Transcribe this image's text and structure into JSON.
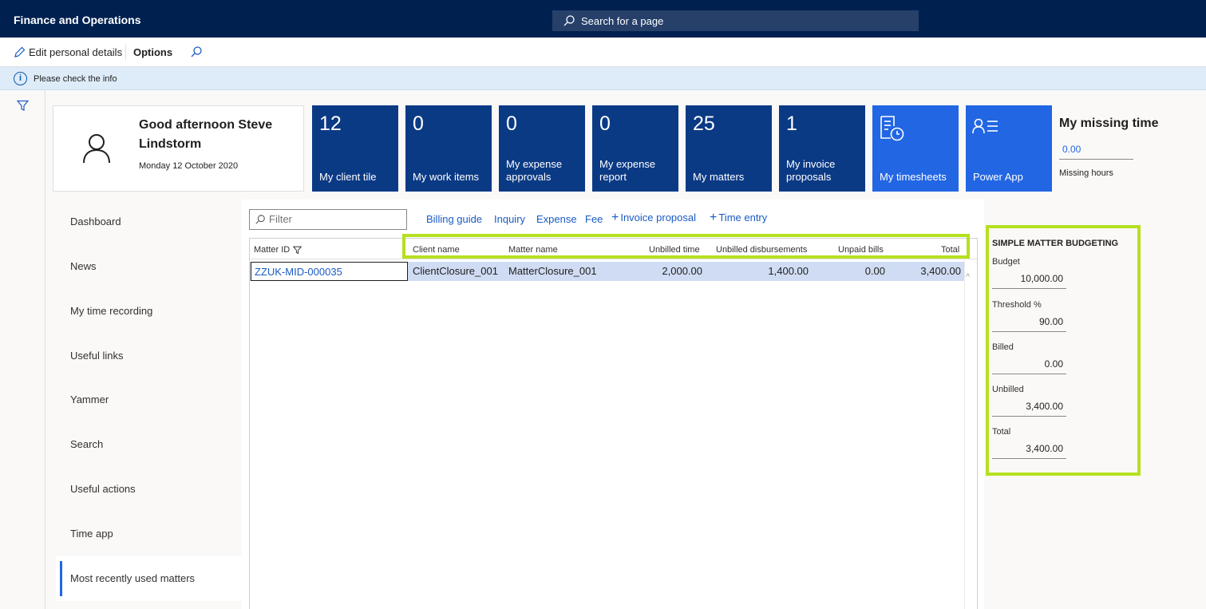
{
  "app": {
    "title": "Finance and Operations",
    "search_placeholder": "Search for a page"
  },
  "actionbar": {
    "edit_label": "Edit personal details",
    "options_label": "Options"
  },
  "info": {
    "message": "Please check the info",
    "icon_glyph": "i"
  },
  "greeting": {
    "text": "Good afternoon Steve Lindstorm",
    "date": "Monday 12 October 2020"
  },
  "tiles": [
    {
      "count": "12",
      "label": "My client tile"
    },
    {
      "count": "0",
      "label": "My work items"
    },
    {
      "count": "0",
      "label": "My expense approvals"
    },
    {
      "count": "0",
      "label": "My expense report"
    },
    {
      "count": "25",
      "label": "My matters"
    },
    {
      "count": "1",
      "label": "My invoice proposals"
    },
    {
      "label": "My timesheets",
      "icon": "timesheet-icon"
    },
    {
      "label": "Power App",
      "icon": "contact-list-icon"
    }
  ],
  "missing_time": {
    "title": "My missing time",
    "value": "0.00",
    "subtitle": "Missing hours"
  },
  "nav": [
    "Dashboard",
    "News",
    "My time recording",
    "Useful links",
    "Yammer",
    "Search",
    "Useful actions",
    "Time app",
    "Most recently used matters"
  ],
  "toolbar": {
    "filter_placeholder": "Filter",
    "links": [
      "Billing guide",
      "Inquiry",
      "Expense",
      "Fee",
      "Invoice proposal",
      "Time entry"
    ],
    "plus_glyph": "+"
  },
  "grid": {
    "columns": [
      "Matter ID",
      "Client name",
      "Matter name",
      "Unbilled time",
      "Unbilled disbursements",
      "Unpaid bills",
      "Total"
    ],
    "rows": [
      [
        "ZZUK-MID-000035",
        "ClientClosure_001",
        "MatterClosure_001",
        "2,000.00",
        "1,400.00",
        "0.00",
        "3,400.00"
      ]
    ],
    "scroll_glyph": "^"
  },
  "budgeting": {
    "title": "SIMPLE MATTER BUDGETING",
    "fields": [
      {
        "label": "Budget",
        "value": "10,000.00"
      },
      {
        "label": "Threshold %",
        "value": "90.00"
      },
      {
        "label": "Billed",
        "value": "0.00"
      },
      {
        "label": "Unbilled",
        "value": "3,400.00"
      },
      {
        "label": "Total",
        "value": "3,400.00"
      }
    ]
  },
  "colors": {
    "nav_bar": "#002050",
    "tile_dark": "#0b3a85",
    "tile_light": "#2266e3",
    "highlight": "#b5e020",
    "link": "#1a5bc4"
  }
}
